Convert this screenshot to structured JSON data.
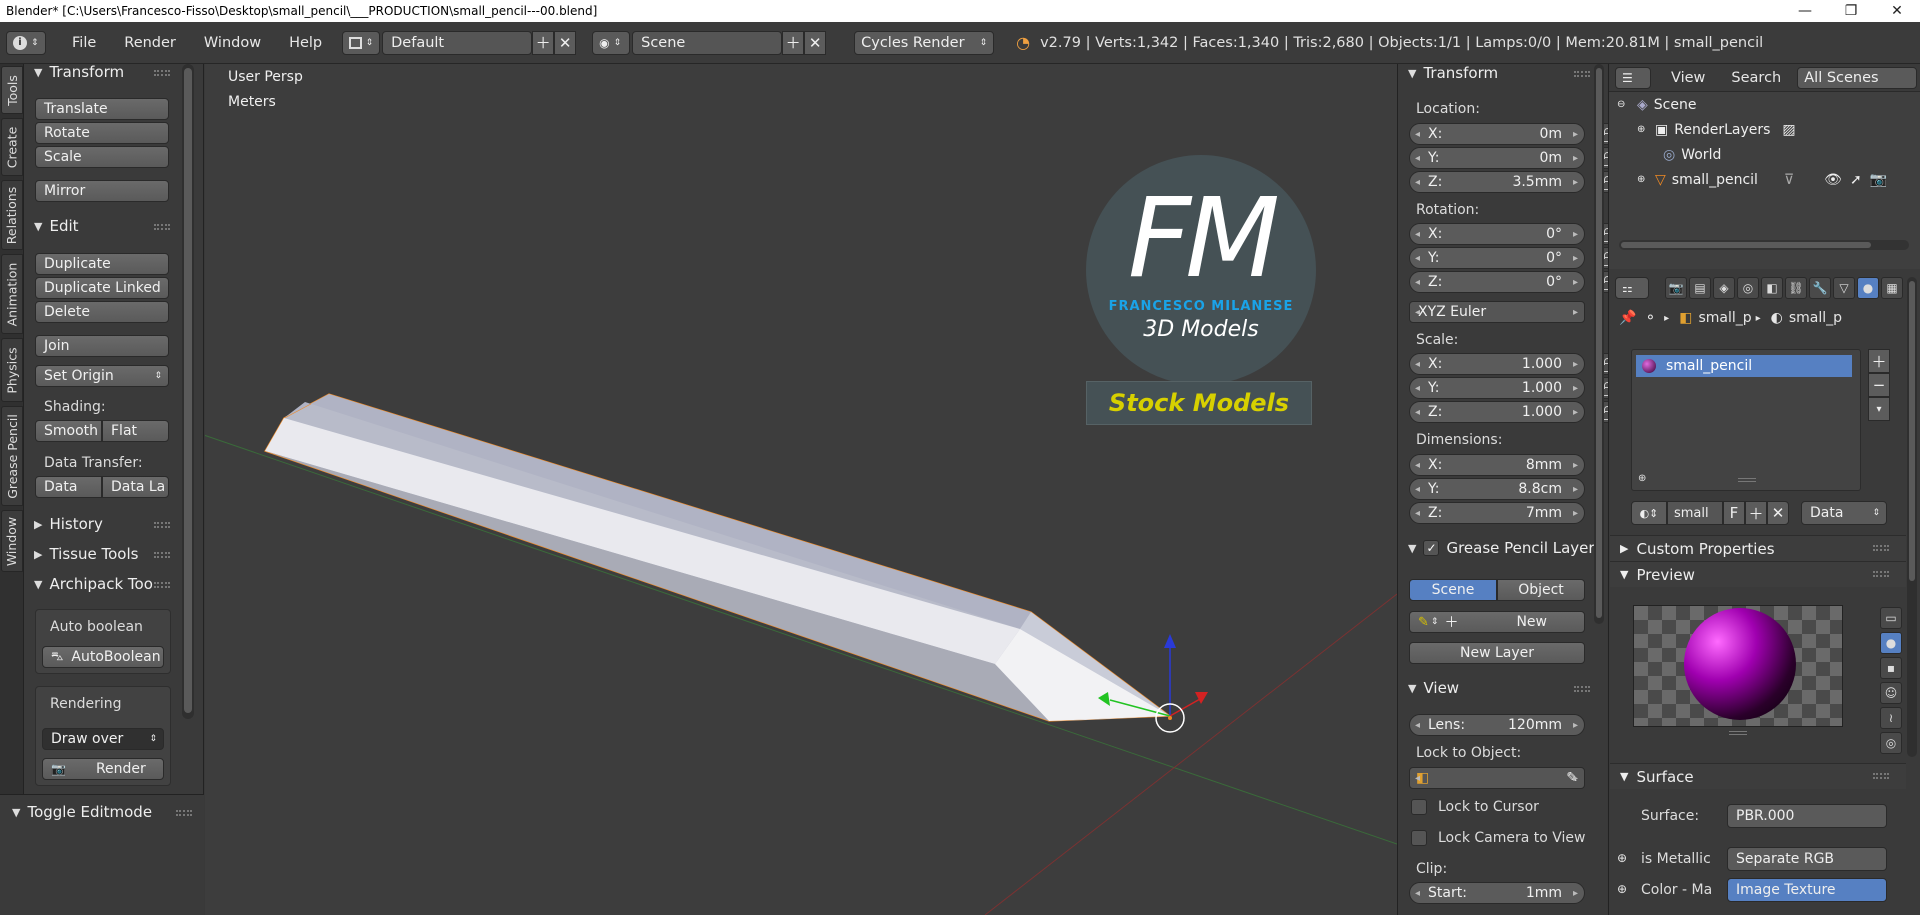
{
  "window": {
    "title": "Blender* [C:\\Users\\Francesco-Fisso\\Desktop\\small_pencil\\___PRODUCTION\\small_pencil---00.blend]",
    "minimize": "—",
    "maximize": "❐",
    "close": "✕"
  },
  "info": {
    "menus": [
      "File",
      "Render",
      "Window",
      "Help"
    ],
    "layout": "Default",
    "scene": "Scene",
    "engine": "Cycles Render",
    "stats": "v2.79 | Verts:1,342 | Faces:1,340 | Tris:2,680 | Objects:1/1 | Lamps:0/0 | Mem:20.81M | small_pencil"
  },
  "lefttabs": [
    "Tools",
    "Create",
    "Relations",
    "Animation",
    "Physics",
    "Grease Pencil",
    "Window"
  ],
  "tools": {
    "transform_header": "Transform",
    "translate": "Translate",
    "rotate": "Rotate",
    "scale": "Scale",
    "mirror": "Mirror",
    "edit_header": "Edit",
    "duplicate": "Duplicate",
    "duplicate_linked": "Duplicate Linked",
    "delete": "Delete",
    "join": "Join",
    "set_origin": "Set Origin",
    "shading_label": "Shading:",
    "smooth": "Smooth",
    "flat": "Flat",
    "data_transfer_label": "Data Transfer:",
    "data": "Data",
    "data_layout": "Data La",
    "history": "History",
    "tissue": "Tissue Tools",
    "archipack": "Archipack Tools",
    "auto_boolean_label": "Auto boolean",
    "auto_boolean_btn": "AutoBoolean",
    "rendering_label": "Rendering",
    "draw_over": "Draw over",
    "render": "Render",
    "toggle_editmode": "Toggle Editmode"
  },
  "viewport": {
    "view_name": "User Persp",
    "units": "Meters",
    "logo_letters": "FM",
    "logo_name": "FRANCESCO MILANESE",
    "logo_sub": "3D Models",
    "stock": "Stock Models"
  },
  "npanel": {
    "transform_header": "Transform",
    "location_label": "Location:",
    "loc": [
      {
        "axis": "X:",
        "value": "0m"
      },
      {
        "axis": "Y:",
        "value": "0m"
      },
      {
        "axis": "Z:",
        "value": "3.5mm"
      }
    ],
    "rotation_label": "Rotation:",
    "rot": [
      {
        "axis": "X:",
        "value": "0°"
      },
      {
        "axis": "Y:",
        "value": "0°"
      },
      {
        "axis": "Z:",
        "value": "0°"
      }
    ],
    "rot_mode": "XYZ Euler",
    "scale_label": "Scale:",
    "scl": [
      {
        "axis": "X:",
        "value": "1.000"
      },
      {
        "axis": "Y:",
        "value": "1.000"
      },
      {
        "axis": "Z:",
        "value": "1.000"
      }
    ],
    "dimensions_label": "Dimensions:",
    "dim": [
      {
        "axis": "X:",
        "value": "8mm"
      },
      {
        "axis": "Y:",
        "value": "8.8cm"
      },
      {
        "axis": "Z:",
        "value": "7mm"
      }
    ],
    "gp_header": "Grease Pencil Layer",
    "gp_scene": "Scene",
    "gp_object": "Object",
    "gp_new": "New",
    "gp_new_layer": "New Layer",
    "view_header": "View",
    "lens_label": "Lens:",
    "lens_value": "120mm",
    "lock_obj_label": "Lock to Object:",
    "lock_cursor": "Lock to Cursor",
    "lock_camera": "Lock Camera to View",
    "clip_label": "Clip:",
    "clip_start_label": "Start:",
    "clip_start_value": "1mm"
  },
  "outliner": {
    "view": "View",
    "search": "Search",
    "filter": "All Scenes",
    "items": [
      "Scene",
      "RenderLayers",
      "World",
      "small_pencil"
    ]
  },
  "props": {
    "bc_obj": "small_p",
    "bc_mat": "small_p",
    "slot": "small_pencil",
    "mat_name": "small",
    "mat_f": "F",
    "link": "Data",
    "custom_props": "Custom Properties",
    "preview": "Preview",
    "surface_header": "Surface",
    "surface_label": "Surface:",
    "surface_value": "PBR.000",
    "metallic_label": "is Metallic",
    "metallic_value": "Separate RGB",
    "color_label": "Color - Ma",
    "color_value": "Image Texture"
  },
  "colors": {
    "accent_blue": "#5680c2",
    "logo_blue": "#1aa3e8",
    "stock_yellow": "#d7d000",
    "outline_orange": "#f08a24"
  }
}
